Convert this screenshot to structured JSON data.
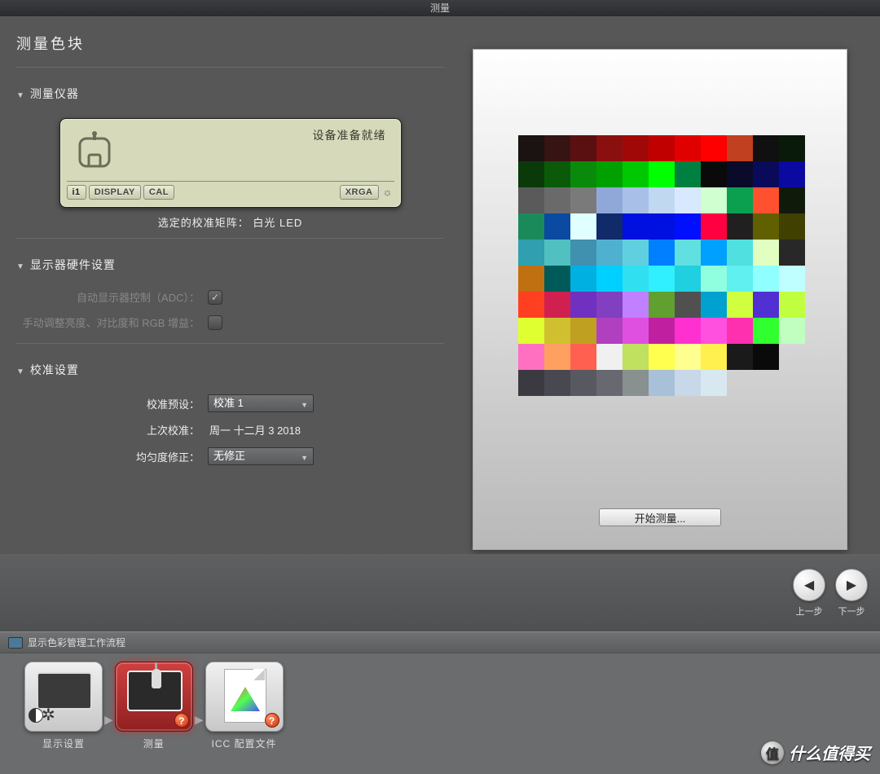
{
  "window": {
    "title": "测量"
  },
  "page": {
    "title": "测量色块"
  },
  "sections": {
    "instrument": {
      "title": "测量仪器"
    },
    "hardware": {
      "title": "显示器硬件设置"
    },
    "calibration": {
      "title": "校准设置"
    }
  },
  "device": {
    "status": "设备准备就绪",
    "bar": {
      "i1": "i1",
      "display": "DISPLAY",
      "cal": "CAL",
      "xrga": "XRGA"
    },
    "caption_label": "选定的校准矩阵：",
    "caption_value": "白光 LED"
  },
  "hardware": {
    "adc_label": "自动显示器控制（ADC）：",
    "adc_checked": true,
    "manual_label": "手动调整亮度、对比度和 RGB 增益：",
    "manual_checked": false
  },
  "calibration": {
    "preset_label": "校准预设：",
    "preset_value": "校准 1",
    "last_label": "上次校准：",
    "last_value": "周一 十二月 3 2018",
    "uniformity_label": "均匀度修正：",
    "uniformity_value": "无修正"
  },
  "preview": {
    "start_button": "开始测量...",
    "patches": [
      [
        "#1b1212",
        "#361414",
        "#5a1010",
        "#8a1010",
        "#a00808",
        "#c00000",
        "#e00000",
        "#ff0000",
        "#c04020",
        "#101010",
        "#0a1a0a"
      ],
      [
        "#0a3a0a",
        "#0a5a0a",
        "#0a8a0a",
        "#00a000",
        "#00c800",
        "#00ff00",
        "#008040",
        "#0a0a0a",
        "#0a0a2a",
        "#0a0a5a",
        "#0a0aa0"
      ],
      [
        "#5a5a5a",
        "#6a6a6a",
        "#7a7a7a",
        "#90a8d8",
        "#a8c0e8",
        "#c0d8f0",
        "#d8e8ff",
        "#d0ffd0",
        "#0aa050",
        "#ff5030",
        "#101a0a"
      ],
      [
        "#1a8a5a",
        "#0a4aa0",
        "#e0ffff",
        "#102a6a",
        "#0010e0",
        "#0010e0",
        "#0010ff",
        "#ff0040",
        "#202020",
        "#606000",
        "#404000"
      ],
      [
        "#30a0b0",
        "#50c0c0",
        "#4090b0",
        "#50b0d0",
        "#60d0e0",
        "#0080ff",
        "#60e0e0",
        "#00a0ff",
        "#50e0e0",
        "#e0ffc0",
        "#282828"
      ],
      [
        "#c07010",
        "#005a5a",
        "#00b0e0",
        "#00d0ff",
        "#30e0f0",
        "#30f0ff",
        "#20d0e0",
        "#90ffe0",
        "#60f0f0",
        "#90ffff",
        "#c0ffff"
      ],
      [
        "#ff4020",
        "#d02050",
        "#7030c0",
        "#8040c0",
        "#c080ff",
        "#60a030",
        "#505050",
        "#00a0d0",
        "#d0ff40",
        "#5030d0",
        "#c0ff40"
      ],
      [
        "#e0ff30",
        "#d0c030",
        "#c0a020",
        "#b040c0",
        "#e050e0",
        "#c020a0",
        "#ff30d0",
        "#ff50e0",
        "#ff30b0",
        "#30ff30",
        "#c0ffc0"
      ],
      [
        "#ff70c0",
        "#ffa060",
        "#ff6050",
        "#f0f0f0",
        "#c0e060",
        "#ffff50",
        "#ffff90",
        "#fff050",
        "#1a1a1a",
        "#0a0a0a"
      ],
      [
        "#3a3a40",
        "#484850",
        "#585860",
        "#686870",
        "#889090",
        "#a8c0d8",
        "#c8d8e8",
        "#d8e8f0"
      ]
    ]
  },
  "nav": {
    "prev": "上一步",
    "next": "下一步"
  },
  "workflow": {
    "title": "显示色彩管理工作流程",
    "items": [
      {
        "label": "显示设置",
        "active": false
      },
      {
        "label": "测量",
        "active": true
      },
      {
        "label": "ICC 配置文件",
        "active": false
      }
    ]
  },
  "watermark": "什么值得买",
  "watermark_badge": "值"
}
